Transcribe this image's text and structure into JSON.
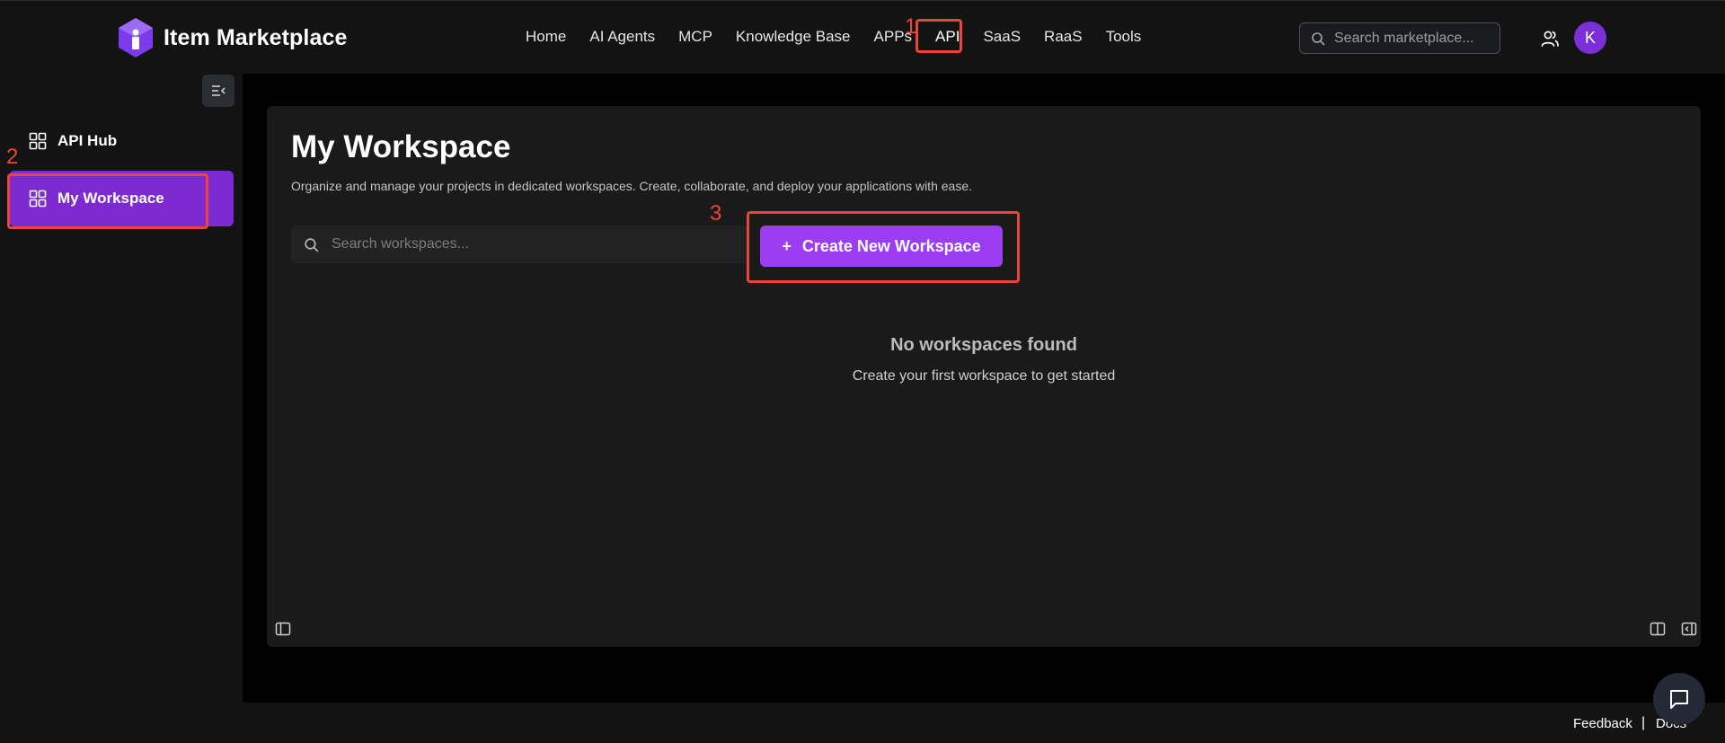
{
  "brand": {
    "name": "Item Marketplace",
    "accent": "#7d2ad3"
  },
  "nav": {
    "items": [
      {
        "label": "Home"
      },
      {
        "label": "AI Agents"
      },
      {
        "label": "MCP"
      },
      {
        "label": "Knowledge Base"
      },
      {
        "label": "APPs"
      },
      {
        "label": "API",
        "active": true
      },
      {
        "label": "SaaS"
      },
      {
        "label": "RaaS"
      },
      {
        "label": "Tools"
      }
    ],
    "search_placeholder": "Search marketplace...",
    "avatar_initial": "K"
  },
  "sidebar": {
    "items": [
      {
        "label": "API Hub",
        "active": false
      },
      {
        "label": "My Workspace",
        "active": true
      }
    ]
  },
  "main": {
    "title": "My Workspace",
    "subtitle": "Organize and manage your projects in dedicated workspaces. Create, collaborate, and deploy your applications with ease.",
    "search_placeholder": "Search workspaces...",
    "create_button": "Create New Workspace",
    "create_button_icon": "+",
    "empty_title": "No workspaces found",
    "empty_subtitle": "Create your first workspace to get started"
  },
  "footer": {
    "feedback": "Feedback",
    "separator": "|",
    "docs": "Docs"
  },
  "annotations": [
    {
      "number": "1",
      "target": "nav API"
    },
    {
      "number": "2",
      "target": "sidebar My Workspace"
    },
    {
      "number": "3",
      "target": "Create New Workspace button"
    }
  ],
  "annotation_color": "#e8463b"
}
